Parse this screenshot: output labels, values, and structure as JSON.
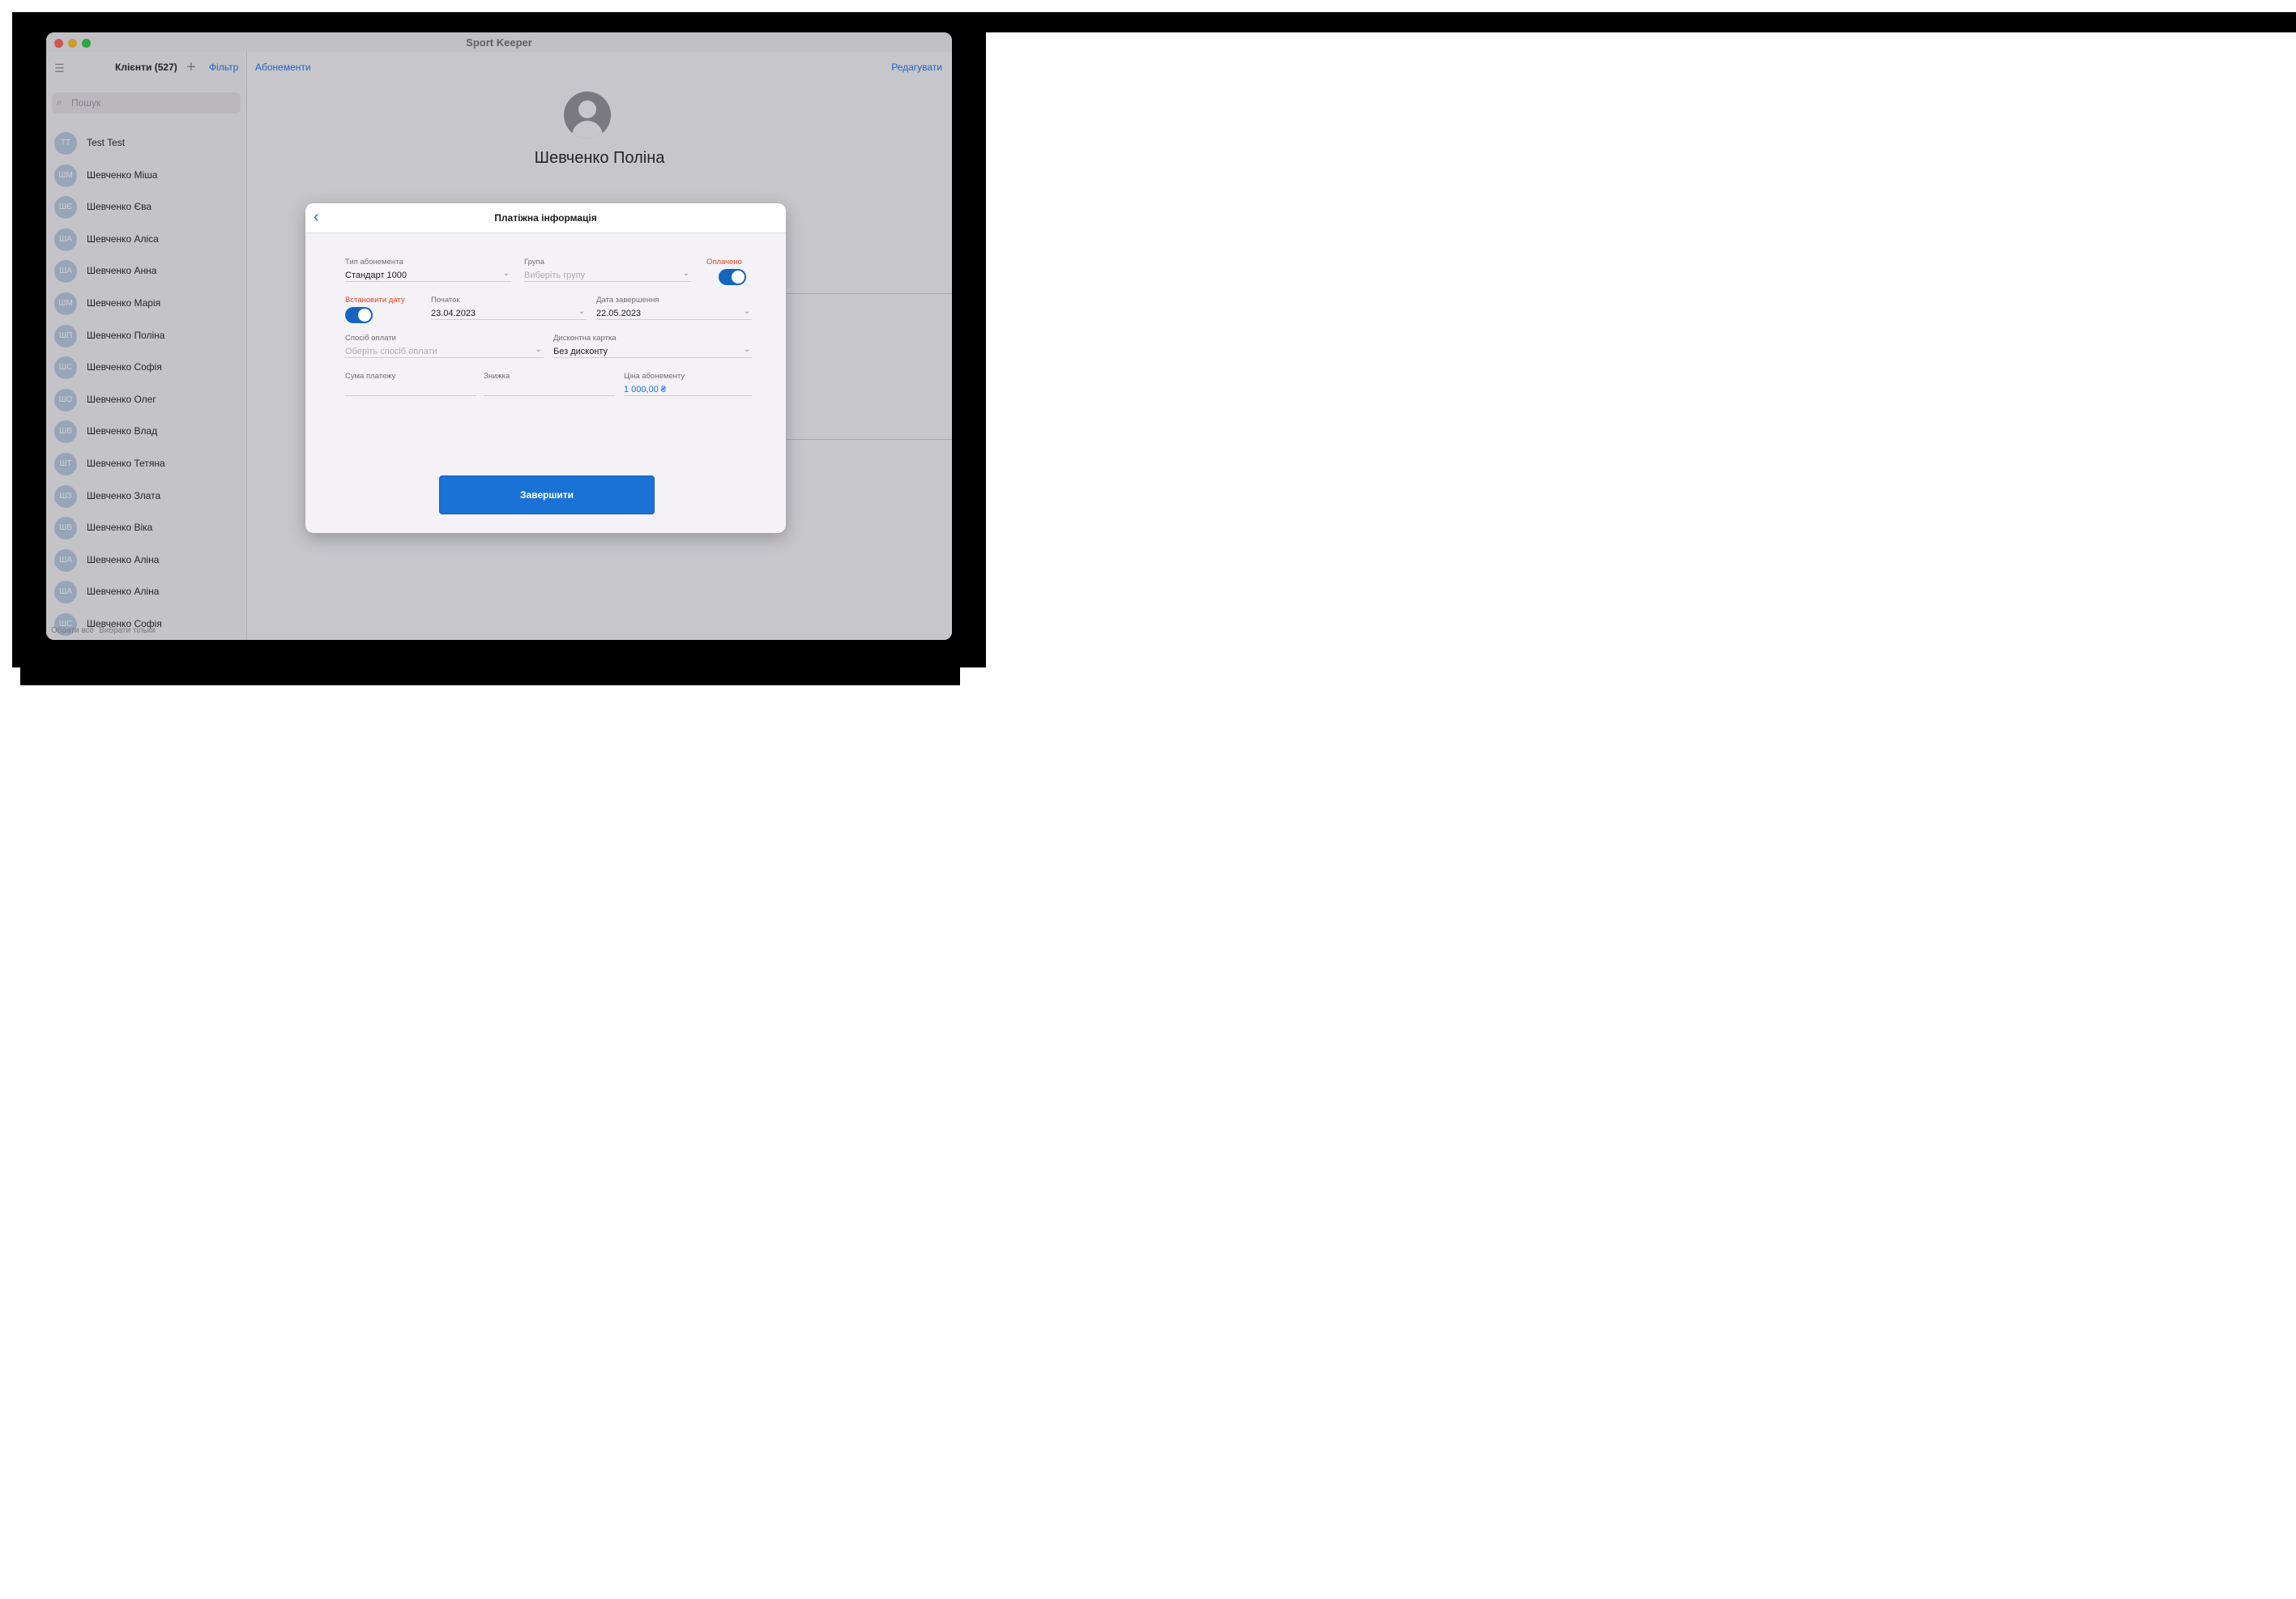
{
  "window": {
    "title": "Sport Keeper"
  },
  "sidebar": {
    "menu_icon": "menu-icon",
    "title": "Клієнти (527)",
    "add_icon": "plus-icon",
    "filter_label": "Фільтр",
    "search_placeholder": "Пошук",
    "clients": [
      {
        "initials": "TT",
        "name": "Test Test"
      },
      {
        "initials": "ШМ",
        "name": "Шевченко Міша"
      },
      {
        "initials": "ШЄ",
        "name": "Шевченко Єва"
      },
      {
        "initials": "ША",
        "name": "Шевченко Аліса"
      },
      {
        "initials": "ША",
        "name": "Шевченко Анна"
      },
      {
        "initials": "ШМ",
        "name": "Шевченко Марія"
      },
      {
        "initials": "ШП",
        "name": "Шевченко Поліна"
      },
      {
        "initials": "ШС",
        "name": "Шевченко Софія"
      },
      {
        "initials": "ШО",
        "name": "Шевченко Олег"
      },
      {
        "initials": "ШВ",
        "name": "Шевченко Влад"
      },
      {
        "initials": "ШТ",
        "name": "Шевченко Тетяна"
      },
      {
        "initials": "ШЗ",
        "name": "Шевченко Злата"
      },
      {
        "initials": "ШВ",
        "name": "Шевченко Віка"
      },
      {
        "initials": "ША",
        "name": "Шевченко Аліна"
      },
      {
        "initials": "ША",
        "name": "Шевченко Аліна"
      },
      {
        "initials": "ШС",
        "name": "Шевченко Софія"
      }
    ],
    "footer": {
      "select_all": "Обрати все",
      "select_only": "Вибрати тільки"
    }
  },
  "content": {
    "subscriptions_link": "Абонементи",
    "edit_link": "Редагувати",
    "profile_name": "Шевченко Поліна"
  },
  "modal": {
    "title": "Платіжна інформація",
    "back_icon": "chevron-left-icon",
    "subscription_type": {
      "label": "Тип абонемента",
      "value": "Стандарт 1000"
    },
    "group": {
      "label": "Група",
      "placeholder": "Виберіть групу"
    },
    "paid": {
      "label": "Оплачено",
      "on": true
    },
    "set_date": {
      "label": "Встановити дату",
      "on": true
    },
    "start": {
      "label": "Початок",
      "value": "23.04.2023"
    },
    "end_date": {
      "label": "Дата завершення",
      "value": "22.05.2023"
    },
    "payment_method": {
      "label": "Спосіб оплати",
      "placeholder": "Оберіть спосіб оплати"
    },
    "discount_card": {
      "label": "Дисконтна картка",
      "value": "Без дисконту"
    },
    "payment_sum": {
      "label": "Сума платежу",
      "value": ""
    },
    "discount": {
      "label": "Знижка",
      "value": ""
    },
    "price": {
      "label": "Ціна абонементу",
      "value": "1 000,00 ₴"
    },
    "finish_button": "Завершити"
  },
  "colors": {
    "accent": "#1b72d6",
    "warning_label": "#e5411f",
    "toggle_on": "#1565c0"
  }
}
